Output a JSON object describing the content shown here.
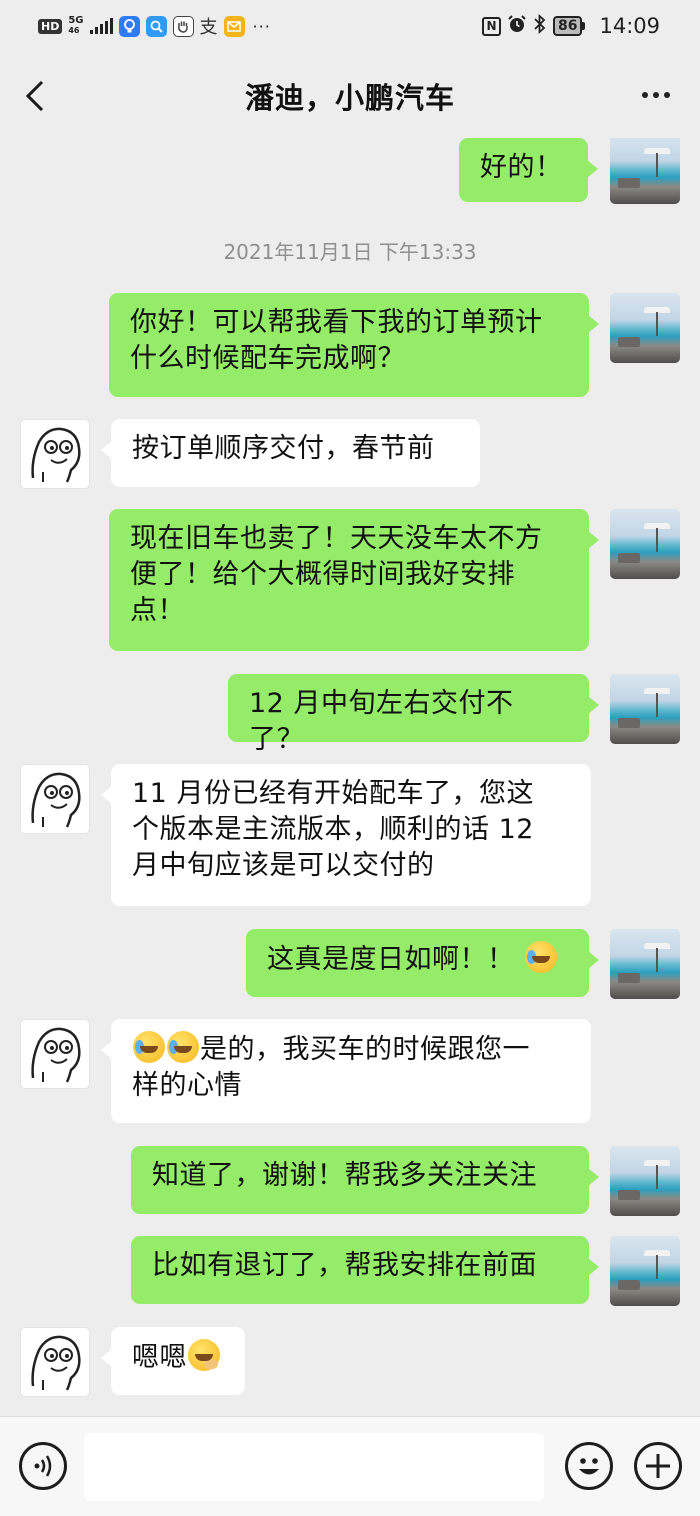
{
  "status_bar": {
    "hd": "HD",
    "signal": "5G",
    "signal_sub": "46",
    "app_icons": [
      {
        "name": "bulb-icon",
        "glyph": "💡",
        "color": "#2f7bf6"
      },
      {
        "name": "search-app-icon",
        "glyph": "Q",
        "color": "#2f9bf6"
      },
      {
        "name": "hand-icon",
        "glyph": "✋",
        "color": "#555555"
      },
      {
        "name": "alipay-icon",
        "glyph": "支",
        "color": "#333333"
      },
      {
        "name": "mail-icon",
        "glyph": "✉",
        "color": "#f3a21b"
      }
    ],
    "more_dots": "···",
    "nfc_icon": "N",
    "alarm_icon": "⏰",
    "bluetooth_icon": "✱",
    "battery": "86",
    "time": "14:09"
  },
  "header": {
    "title": "潘迪，小鹏汽车"
  },
  "messages": [
    {
      "side": "out",
      "text": "好的！"
    },
    {
      "type": "time",
      "text": "2021年11月1日 下午13:33"
    },
    {
      "side": "out",
      "lines": [
        "你好！可以帮我看下我的订单预计",
        "什么时候配车完成啊？"
      ]
    },
    {
      "side": "in",
      "text": "按订单顺序交付，春节前"
    },
    {
      "side": "out",
      "lines": [
        "现在旧车也卖了！天天没车太不方",
        "便了！给个大概得时间我好安排",
        "点！"
      ]
    },
    {
      "side": "out",
      "text": "12 月中旬左右交付不了？"
    },
    {
      "side": "in",
      "lines": [
        "11 月份已经有开始配车了，您这",
        "个版本是主流版本，顺利的话 12",
        "月中旬应该是可以交付的"
      ]
    },
    {
      "side": "out",
      "text": "这真是度日如啊！！",
      "emoji": "cry"
    },
    {
      "side": "in",
      "line1": "是的，我买车的时候跟您一",
      "line2": "样的心情",
      "emojis_before": 2
    },
    {
      "side": "out",
      "text": "知道了，谢谢！帮我多关注关注"
    },
    {
      "side": "out",
      "text": "比如有退订了，帮我安排在前面"
    },
    {
      "side": "in",
      "text": "嗯嗯",
      "emoji": "wink"
    }
  ],
  "input_bar": {
    "placeholder": ""
  }
}
